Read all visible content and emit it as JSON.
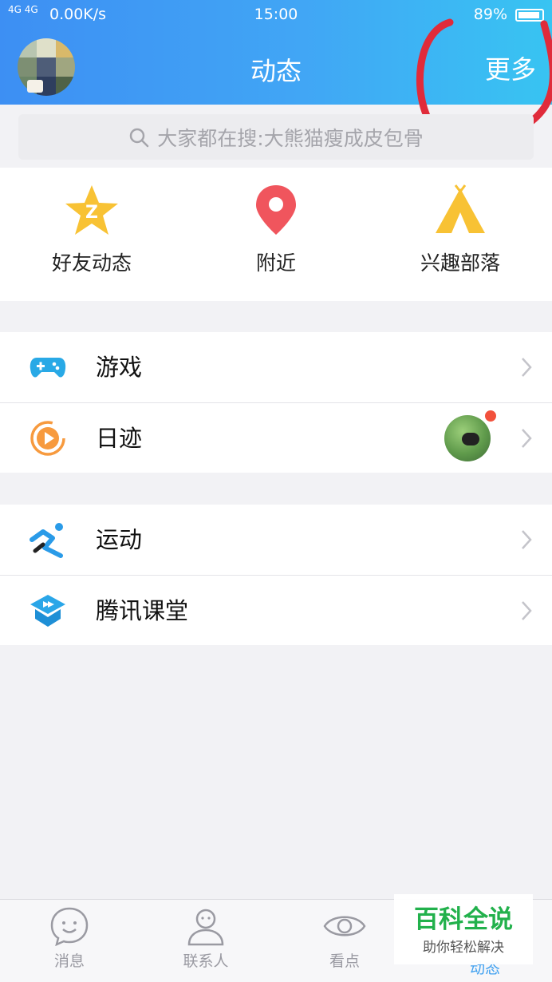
{
  "status_bar": {
    "signal": "4G 4G",
    "speed": "0.00K/s",
    "time": "15:00",
    "battery": "89%"
  },
  "header": {
    "title": "动态",
    "more_label": "更多"
  },
  "search": {
    "placeholder": "大家都在搜:大熊猫瘦成皮包骨"
  },
  "quick_actions": [
    {
      "label": "好友动态",
      "icon": "qzone-star-icon"
    },
    {
      "label": "附近",
      "icon": "location-pin-icon"
    },
    {
      "label": "兴趣部落",
      "icon": "tent-icon"
    }
  ],
  "menu_group_1": [
    {
      "label": "游戏",
      "icon": "gamepad-icon"
    },
    {
      "label": "日迹",
      "icon": "play-circle-icon"
    }
  ],
  "menu_group_2": [
    {
      "label": "运动",
      "icon": "running-icon"
    },
    {
      "label": "腾讯课堂",
      "icon": "classroom-icon"
    }
  ],
  "tabbar": [
    {
      "label": "消息",
      "icon": "chat-bubble-icon"
    },
    {
      "label": "联系人",
      "icon": "person-icon"
    },
    {
      "label": "看点",
      "icon": "eye-icon"
    },
    {
      "label": "动态",
      "icon": "star-icon",
      "active": true
    }
  ],
  "watermark": {
    "title": "百科全说",
    "subtitle": "助你轻松解决"
  },
  "colors": {
    "header_start": "#3d8ff3",
    "header_end": "#38c4f2",
    "annotation": "#e02b3a",
    "active_tab": "#3fa0f0"
  }
}
